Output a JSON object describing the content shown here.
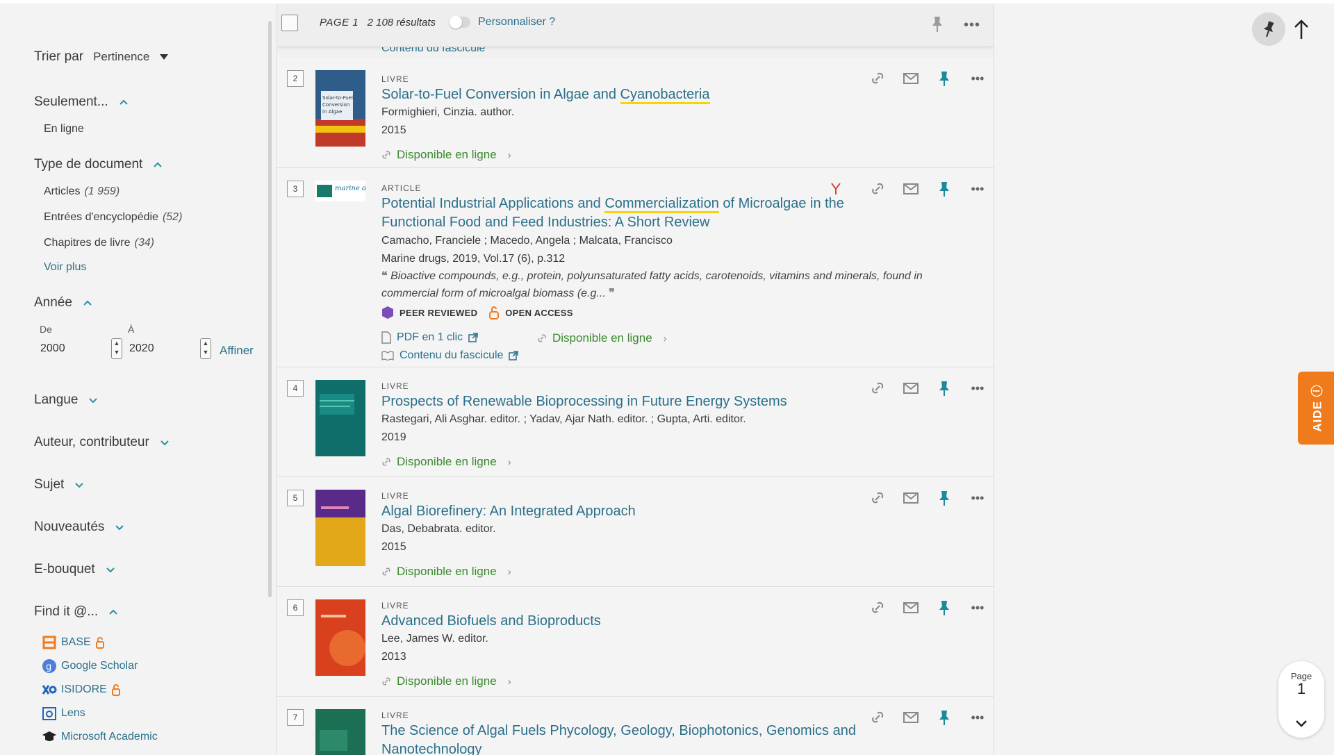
{
  "sidebar": {
    "sort_label": "Trier par",
    "sort_value": "Pertinence",
    "only_title": "Seulement...",
    "only_items": [
      "En ligne"
    ],
    "doctype_title": "Type de document",
    "doctype_items": [
      {
        "label": "Articles",
        "count": "(1 959)"
      },
      {
        "label": "Entrées d'encyclopédie",
        "count": "(52)"
      },
      {
        "label": "Chapitres de livre",
        "count": "(34)"
      }
    ],
    "see_more": "Voir plus",
    "year_title": "Année",
    "year_from_label": "De",
    "year_to_label": "À",
    "year_from": "2000",
    "year_to": "2020",
    "refine": "Affiner",
    "facets": [
      "Langue",
      "Auteur, contributeur",
      "Sujet",
      "Nouveautés",
      "E-bouquet"
    ],
    "findit_title": "Find it @...",
    "findit_items": [
      "BASE",
      "Google Scholar",
      "ISIDORE",
      "Lens",
      "Microsoft Academic"
    ]
  },
  "results_bar": {
    "page": "PAGE 1",
    "count": "2 108 résultats",
    "personalize": "Personnaliser ?"
  },
  "peek_text": "Contenu du fascicule",
  "records": [
    {
      "num": "2",
      "type": "LIVRE",
      "title_a": "Solar-to-Fuel Conversion in Algae and ",
      "title_hl": "Cyanobacteria",
      "title_b": "",
      "line1": "Formighieri, Cinzia. author.",
      "line2": "2015",
      "avail": "Disponible en ligne",
      "thumb_text": "Solar-to-Fuel Conversion in Algae and Cyanobacteria",
      "thumb_color": "#2f5d8a"
    },
    {
      "num": "3",
      "type": "ARTICLE",
      "title_a": "Potential Industrial Applications and ",
      "title_hl": "Commercialization",
      "title_b": " of Microalgae in the Functional Food and Feed Industries: A Short Review",
      "line1": "Camacho, Franciele ; Macedo, Angela ; Malcata, Francisco",
      "line2": "Marine drugs, 2019, Vol.17 (6), p.312",
      "snippet": "Bioactive compounds, e.g., protein, polyunsaturated fatty acids, carotenoids, vitamins and minerals, found in commercial form of microalgal biomass (e.g...",
      "badge1": "PEER REVIEWED",
      "badge2": "OPEN ACCESS",
      "pdf": "PDF en 1 clic",
      "avail": "Disponible en ligne",
      "toc": "Contenu du fascicule",
      "thumb_text": "marine drugs"
    },
    {
      "num": "4",
      "type": "LIVRE",
      "title_a": "Prospects of Renewable Bioprocessing in Future Energy Systems",
      "title_hl": "",
      "title_b": "",
      "line1": "Rastegari, Ali Asghar. editor. ; Yadav, Ajar Nath. editor. ; Gupta, Arti. editor.",
      "line2": "2019",
      "avail": "Disponible en ligne",
      "thumb_color": "#0f6e6a"
    },
    {
      "num": "5",
      "type": "LIVRE",
      "title_a": "Algal Biorefinery: An Integrated Approach",
      "title_hl": "",
      "title_b": "",
      "line1": "Das, Debabrata. editor.",
      "line2": "2015",
      "avail": "Disponible en ligne",
      "thumb_color": "#e3a81a"
    },
    {
      "num": "6",
      "type": "LIVRE",
      "title_a": "Advanced Biofuels and Bioproducts",
      "title_hl": "",
      "title_b": "",
      "line1": "Lee, James W. editor.",
      "line2": "2013",
      "avail": "Disponible en ligne",
      "thumb_color": "#d8401e"
    },
    {
      "num": "7",
      "type": "LIVRE",
      "title_a": "The Science of Algal Fuels Phycology, Geology, Biophotonics, Genomics and Nanotechnology",
      "title_hl": "",
      "title_b": "",
      "thumb_color": "#1b6f55"
    }
  ],
  "right": {
    "help": "AIDE",
    "page_label": "Page",
    "page_number": "1"
  },
  "colors": {
    "link": "#2a6f8a",
    "available": "#3a8a2e",
    "pin": "#1b8a9a",
    "help": "#f07b1d",
    "highlight": "#f5d50a"
  }
}
